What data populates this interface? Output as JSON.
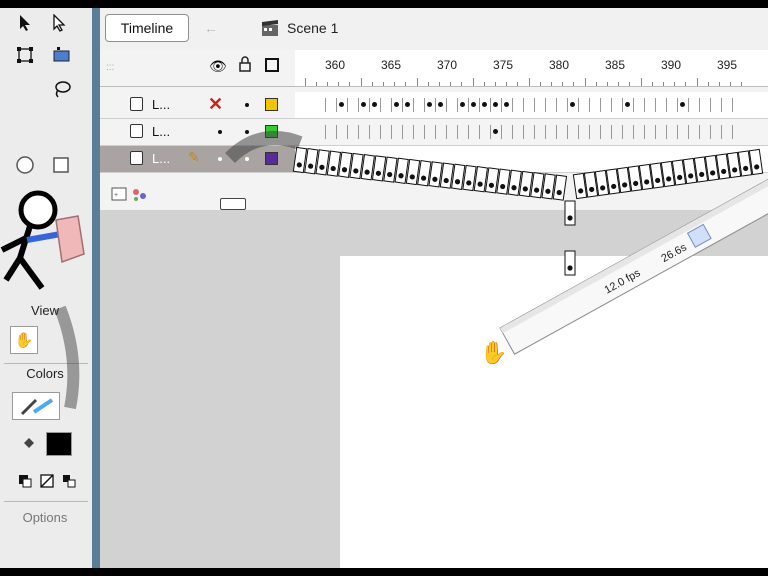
{
  "header": {
    "timeline_label": "Timeline",
    "scene_label": "Scene 1",
    "back_icon": "back-arrow-icon"
  },
  "ruler": {
    "ticks": [
      "360",
      "365",
      "370",
      "375",
      "380",
      "385",
      "390",
      "395"
    ]
  },
  "layers": [
    {
      "name": "L...",
      "color": "#f3c500",
      "visible_icon": "red-x-icon",
      "selected": false
    },
    {
      "name": "L...",
      "color": "#33cc33",
      "visible_icon": "dot",
      "selected": false
    },
    {
      "name": "L...",
      "color": "#5a2a9a",
      "visible_icon": "dot",
      "selected": true
    }
  ],
  "tools_panel": {
    "view_label": "View",
    "colors_label": "Colors",
    "options_label": "Options"
  },
  "ruler_overlay": {
    "fps_label": "12.0 fps",
    "time_label": "26.6s"
  }
}
